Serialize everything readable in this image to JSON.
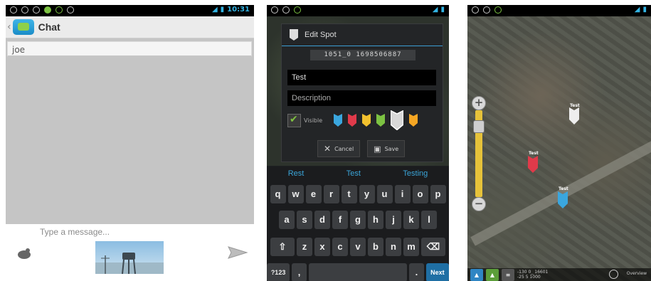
{
  "phone1": {
    "title": "Chat",
    "recipient": "joe",
    "message_placeholder": "Type a message..."
  },
  "phone2": {
    "dialog_title": "Edit Spot",
    "coordinates": "1051_0 1698506887",
    "name_value": "Test",
    "description_placeholder": "Description",
    "visible_label": "Visible",
    "cancel_label": "Cancel",
    "save_label": "Save",
    "suggestions": [
      "Rest",
      "Test",
      "Testing"
    ],
    "keyboard": {
      "row1": [
        "q",
        "w",
        "e",
        "r",
        "t",
        "y",
        "u",
        "i",
        "o",
        "p"
      ],
      "row2": [
        "a",
        "s",
        "d",
        "f",
        "g",
        "h",
        "j",
        "k",
        "l"
      ],
      "row3": [
        "z",
        "x",
        "c",
        "v",
        "b",
        "n",
        "m"
      ],
      "symbols_label": "?123",
      "comma": ",",
      "period": ".",
      "next_label": "Next"
    },
    "marker_colors": [
      "#3aa6de",
      "#e03a4a",
      "#f2c12e",
      "#7cc242",
      "#d8d8d8",
      "#f5a623"
    ]
  },
  "phone3": {
    "pin_labels": [
      "Test",
      "Test",
      "Test"
    ],
    "coord_lines": [
      "-130 0_ 16601",
      "-25 5 1000"
    ],
    "view_label": "Overview"
  }
}
